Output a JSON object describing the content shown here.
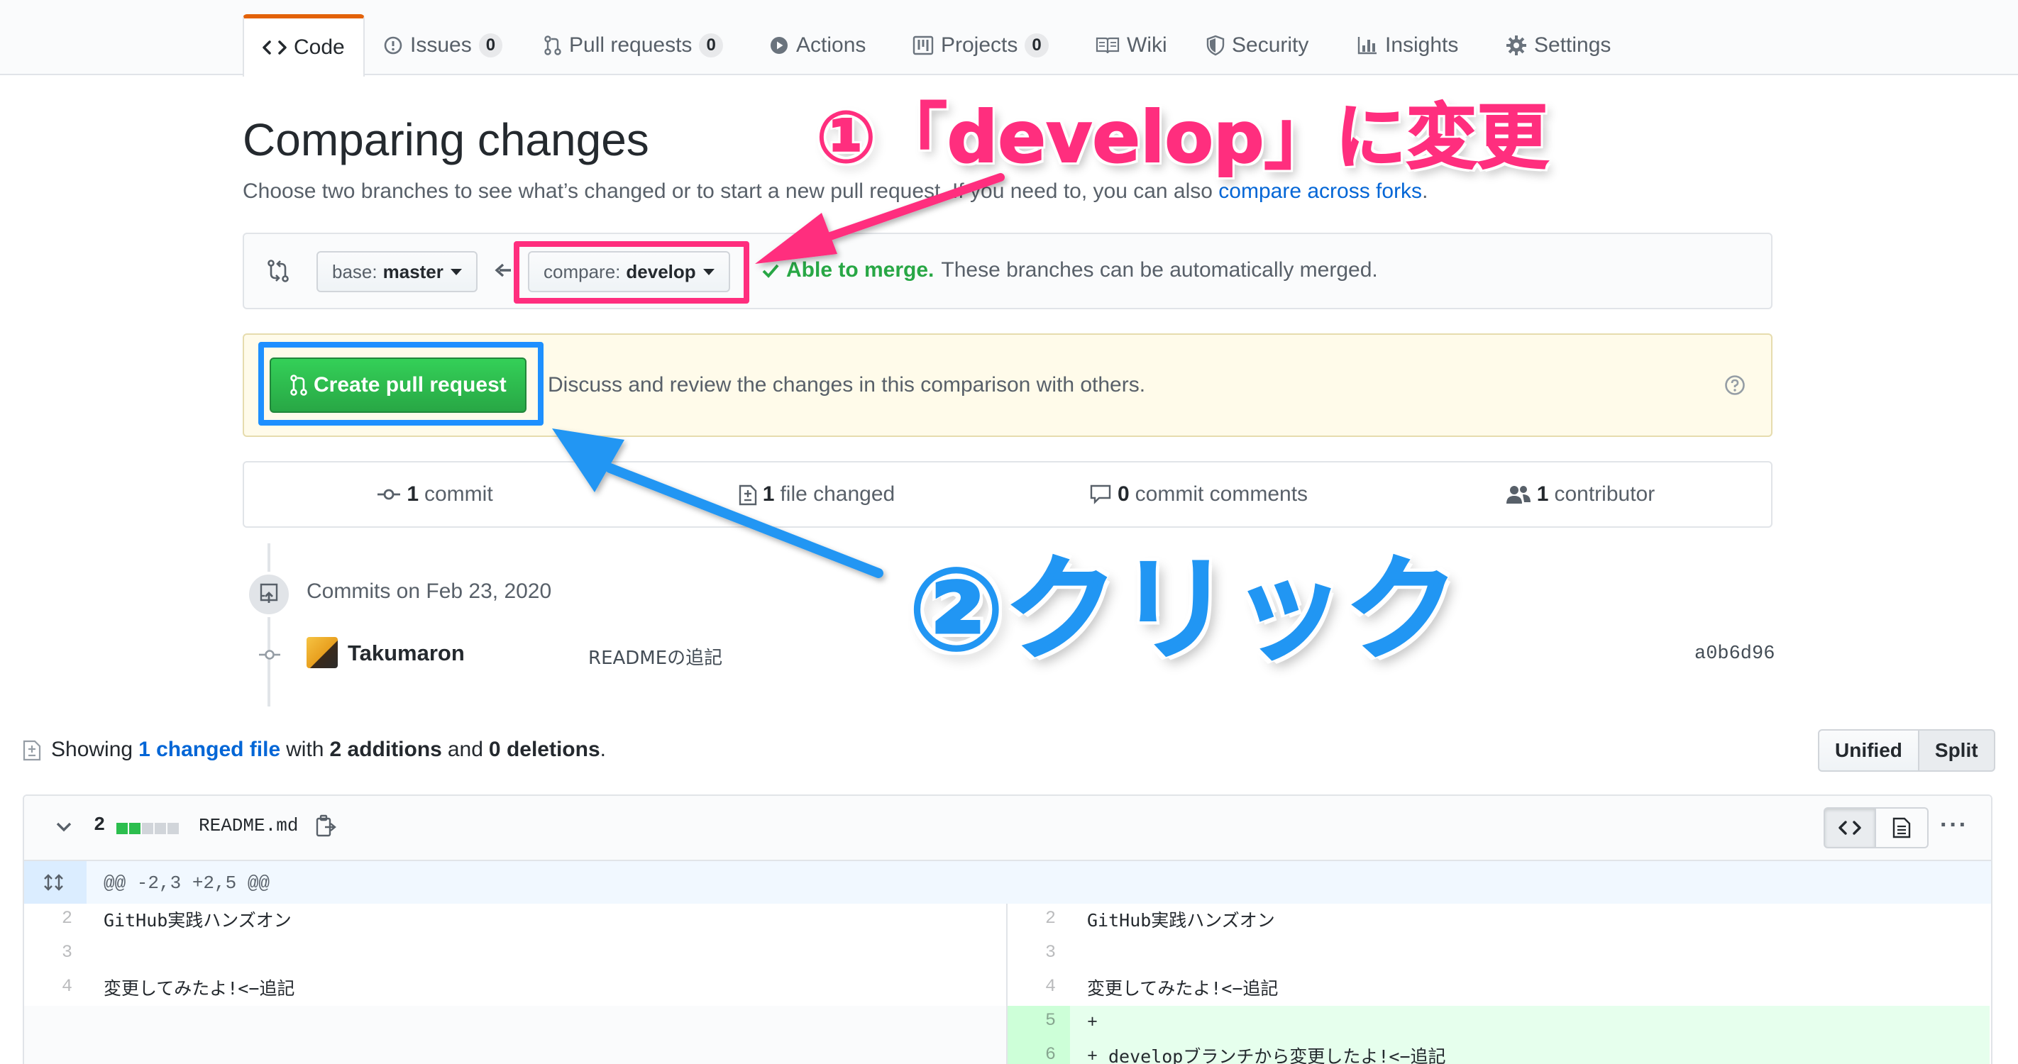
{
  "nav": {
    "tabs": [
      {
        "label": "Code",
        "icon": "code-icon",
        "selected": true
      },
      {
        "label": "Issues",
        "icon": "issue-icon",
        "count": "0"
      },
      {
        "label": "Pull requests",
        "icon": "pull-request-icon",
        "count": "0"
      },
      {
        "label": "Actions",
        "icon": "play-icon"
      },
      {
        "label": "Projects",
        "icon": "project-icon",
        "count": "0"
      },
      {
        "label": "Wiki",
        "icon": "book-icon"
      },
      {
        "label": "Security",
        "icon": "shield-icon"
      },
      {
        "label": "Insights",
        "icon": "graph-icon"
      },
      {
        "label": "Settings",
        "icon": "gear-icon"
      }
    ]
  },
  "header": {
    "title": "Comparing changes",
    "subtitle_text": "Choose two branches to see what’s changed or to start a new pull request. If you need to, you can also ",
    "subtitle_link": "compare across forks",
    "subtitle_end": "."
  },
  "range": {
    "base_label": "base:",
    "base_value": "master",
    "compare_label": "compare:",
    "compare_value": "develop",
    "merge_ok": "Able to merge.",
    "merge_text": "These branches can be automatically merged."
  },
  "pr": {
    "button_label": "Create pull request",
    "description": "Discuss and review the changes in this comparison with others."
  },
  "numbers": {
    "commits_count": "1",
    "commits_label": "commit",
    "files_count": "1",
    "files_label": "file changed",
    "comments_count": "0",
    "comments_label": "commit comments",
    "contributors_count": "1",
    "contributors_label": "contributor"
  },
  "commits": {
    "group_title": "Commits on Feb 23, 2020",
    "items": [
      {
        "author": "Takumaron",
        "message": "READMEの追記",
        "sha": "a0b6d96"
      }
    ]
  },
  "diff_summary": {
    "showing": "Showing",
    "files_link": "1 changed file",
    "with": "with",
    "additions": "2 additions",
    "and": "and",
    "deletions": "0 deletions",
    "end": "."
  },
  "view_toggle": {
    "unified": "Unified",
    "split": "Split"
  },
  "file": {
    "change_count": "2",
    "name": "README.md",
    "more": "···",
    "hunk": "@@ -2,3 +2,5 @@",
    "left_lines": [
      {
        "num": "2",
        "text": "GitHub実践ハンズオン"
      },
      {
        "num": "3",
        "text": ""
      },
      {
        "num": "4",
        "text": "変更してみたよ!<−追記"
      }
    ],
    "right_lines": [
      {
        "num": "2",
        "text": "GitHub実践ハンズオン"
      },
      {
        "num": "3",
        "text": ""
      },
      {
        "num": "4",
        "text": "変更してみたよ!<−追記"
      },
      {
        "num": "5",
        "sign": "+",
        "text": ""
      },
      {
        "num": "6",
        "sign": "+",
        "text": "developブランチから変更したよ!<−追記"
      }
    ]
  },
  "annotations": {
    "step1": "①「develop」に変更",
    "step2": "②クリック",
    "pink": "#ff2e7e",
    "blue": "#2196f3"
  },
  "colors": {
    "accent_tab": "#e36209",
    "link": "#0366d6",
    "green": "#28a745",
    "flash_bg": "#fffbea"
  }
}
